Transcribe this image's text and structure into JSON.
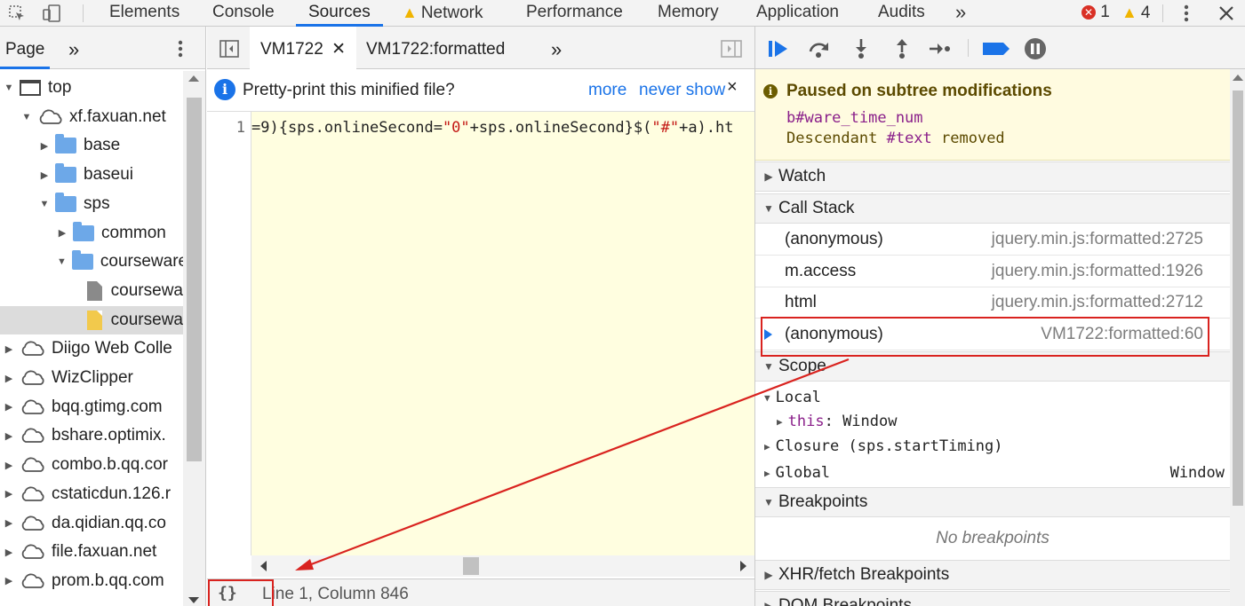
{
  "toolbar": {
    "tabs": [
      "Elements",
      "Console",
      "Sources",
      "Network",
      "Performance",
      "Memory",
      "Application",
      "Audits"
    ],
    "active_tab": "Sources",
    "more_tabs": "»",
    "error_count": "1",
    "warning_count": "4"
  },
  "navigator": {
    "tab_label": "Page",
    "more": "»",
    "tree": [
      {
        "label": "top",
        "icon": "frame-icon",
        "expanded": true,
        "selected": false
      },
      {
        "label": "xf.faxuan.net",
        "icon": "cloud-icon",
        "expanded": true,
        "selected": false
      },
      {
        "label": "base",
        "icon": "folder-icon",
        "expanded": false,
        "selected": false
      },
      {
        "label": "baseui",
        "icon": "folder-icon",
        "expanded": false,
        "selected": false
      },
      {
        "label": "sps",
        "icon": "folder-icon",
        "expanded": true,
        "selected": false
      },
      {
        "label": "common",
        "icon": "folder-icon",
        "expanded": false,
        "selected": false
      },
      {
        "label": "courseware",
        "icon": "folder-icon",
        "expanded": true,
        "selected": false
      },
      {
        "label": "coursewa",
        "icon": "file-icon",
        "expanded": null,
        "selected": false
      },
      {
        "label": "coursewa",
        "icon": "script-file-icon",
        "expanded": null,
        "selected": true
      },
      {
        "label": "Diigo Web Colle",
        "icon": "cloud-icon",
        "expanded": false,
        "selected": false
      },
      {
        "label": "WizClipper",
        "icon": "cloud-icon",
        "expanded": false,
        "selected": false
      },
      {
        "label": "bqq.gtimg.com",
        "icon": "cloud-icon",
        "expanded": false,
        "selected": false
      },
      {
        "label": "bshare.optimix.",
        "icon": "cloud-icon",
        "expanded": false,
        "selected": false
      },
      {
        "label": "combo.b.qq.cor",
        "icon": "cloud-icon",
        "expanded": false,
        "selected": false
      },
      {
        "label": "cstaticdun.126.r",
        "icon": "cloud-icon",
        "expanded": false,
        "selected": false
      },
      {
        "label": "da.qidian.qq.co",
        "icon": "cloud-icon",
        "expanded": false,
        "selected": false
      },
      {
        "label": "file.faxuan.net",
        "icon": "cloud-icon",
        "expanded": false,
        "selected": false
      },
      {
        "label": "prom.b.qq.com",
        "icon": "cloud-icon",
        "expanded": false,
        "selected": false
      }
    ]
  },
  "editor": {
    "tabs": [
      {
        "label": "VM1722",
        "closable": true,
        "active": true
      },
      {
        "label": "VM1722:formatted",
        "closable": false,
        "active": false
      }
    ],
    "more": "»",
    "infobar": {
      "message": "Pretty-print this minified file?",
      "link_more": "more",
      "link_never": "never show",
      "close": "×"
    },
    "line_number": "1",
    "code_parts": [
      {
        "text": "=9){sps.onlineSecond=",
        "color": "#222222"
      },
      {
        "text": "\"0\"",
        "color": "#c41a16"
      },
      {
        "text": "+sps.onlineSecond}$(",
        "color": "#222222"
      },
      {
        "text": "\"#\"",
        "color": "#c41a16"
      },
      {
        "text": "+a).ht",
        "color": "#222222"
      }
    ],
    "status": {
      "format_button": "{}",
      "position": "Line 1, Column 846"
    }
  },
  "debugger": {
    "paused": {
      "title": "Paused on subtree modifications",
      "node": "b#ware_time_num",
      "detail_prefix": "Descendant ",
      "detail_node": "#text",
      "detail_suffix": " removed"
    },
    "sections": {
      "watch": "Watch",
      "call_stack": "Call Stack",
      "scope": "Scope",
      "breakpoints": "Breakpoints",
      "xhr": "XHR/fetch Breakpoints",
      "dom": "DOM Breakpoints"
    },
    "call_stack": [
      {
        "name": "(anonymous)",
        "location": "jquery.min.js:formatted:2725",
        "current": false
      },
      {
        "name": "m.access",
        "location": "jquery.min.js:formatted:1926",
        "current": false
      },
      {
        "name": "html",
        "location": "jquery.min.js:formatted:2712",
        "current": false
      },
      {
        "name": "(anonymous)",
        "location": "VM1722:formatted:60",
        "current": true
      }
    ],
    "scope": {
      "local": "Local",
      "this_key": "this",
      "this_value": "Window",
      "closure": "Closure (sps.startTiming)",
      "global": "Global",
      "global_value": "Window"
    },
    "no_breakpoints": "No breakpoints"
  },
  "colors": {
    "accent": "#1a73e8",
    "highlight_box": "#d9231f",
    "paused_background": "#fffbe0",
    "editor_background": "#fffee0"
  }
}
